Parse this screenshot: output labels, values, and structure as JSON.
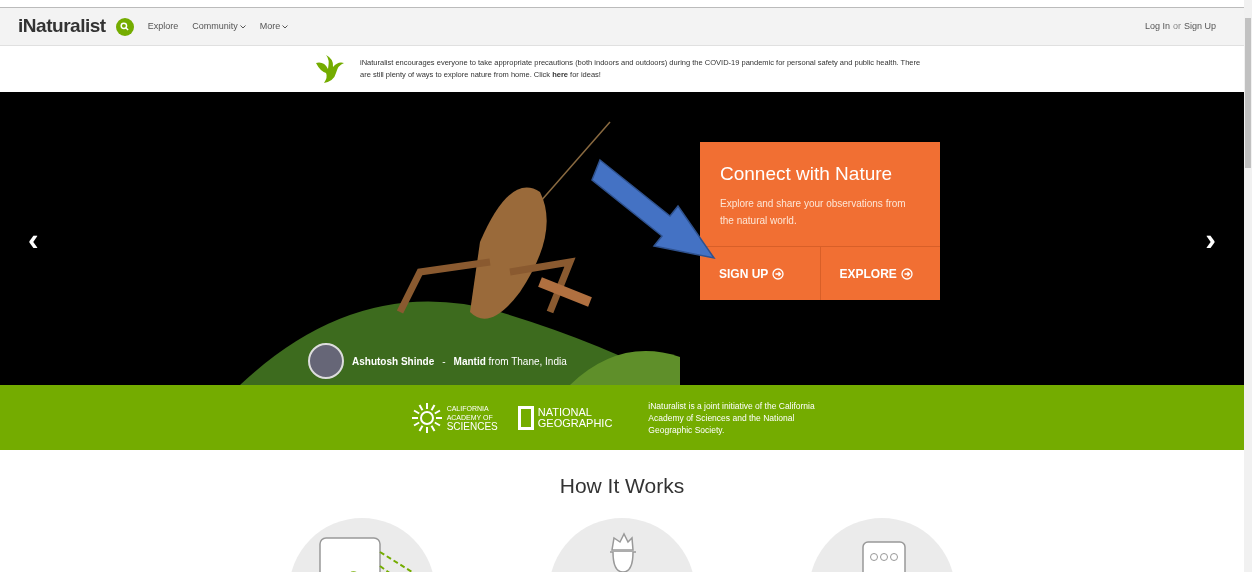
{
  "navbar": {
    "logo": "iNaturalist",
    "links": [
      {
        "label": "Explore",
        "dropdown": false
      },
      {
        "label": "Community",
        "dropdown": true
      },
      {
        "label": "More",
        "dropdown": true
      }
    ],
    "login": "Log In",
    "or": "or",
    "signup": "Sign Up"
  },
  "notice": {
    "text": "iNaturalist encourages everyone to take appropriate precautions (both indoors and outdoors) during the COVID-19 pandemic for personal safety and public health. There are still plenty of ways to explore nature from home. Click **here** for ideas!"
  },
  "hero": {
    "card_title": "Connect with Nature",
    "card_text": "Explore and share your observations from the natural world.",
    "buttons": [
      "SIGN UP",
      "EXPLORE"
    ],
    "photographer": "Ashutosh Shinde",
    "separator": "-",
    "caption": "**Mantid** from Thane, India",
    "prev": "‹",
    "next": "›"
  },
  "partners": {
    "academy": [
      "CALIFORNIA",
      "ACADEMY OF",
      "SCIENCES"
    ],
    "natgeo": [
      "NATIONAL",
      "GEOGRAPHIC"
    ],
    "text": "iNaturalist is a joint initiative of the California Academy of Sciences and the National Geographic Society."
  },
  "how_it_works": {
    "title": "How It Works",
    "steps": [
      {
        "kind": "phone"
      },
      {
        "kind": "person"
      },
      {
        "kind": "chat"
      }
    ]
  }
}
